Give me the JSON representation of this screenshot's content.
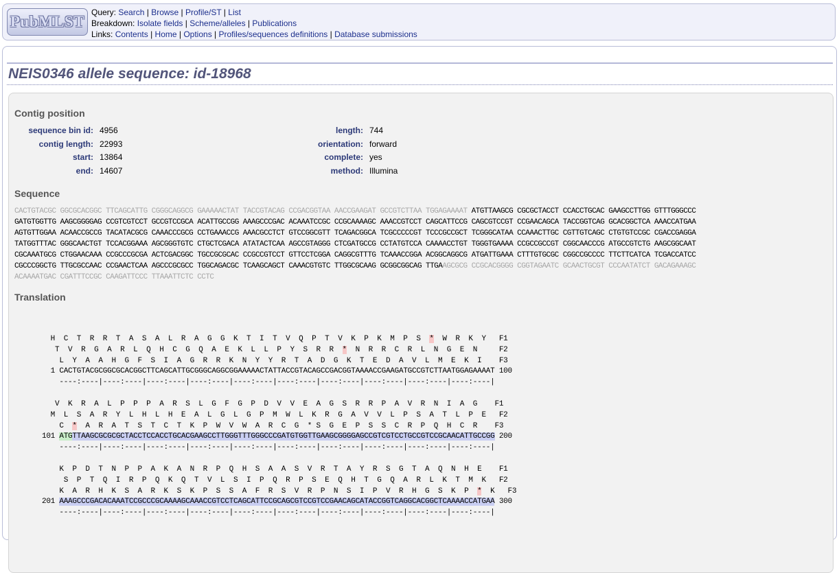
{
  "nav": {
    "logo_text": "PubMLST",
    "query_label": "Query:",
    "query_links": [
      "Search",
      "Browse",
      "Profile/ST",
      "List"
    ],
    "breakdown_label": "Breakdown:",
    "breakdown_links": [
      "Isolate fields",
      "Scheme/alleles",
      "Publications"
    ],
    "links_label": "Links:",
    "links_links": [
      "Contents",
      "Home",
      "Options",
      "Profiles/sequences definitions",
      "Database submissions"
    ]
  },
  "page_title": "NEIS0346 allele sequence: id-18968",
  "contig": {
    "heading": "Contig position",
    "left": [
      {
        "label": "sequence bin id:",
        "value": "4956"
      },
      {
        "label": "contig length:",
        "value": "22993"
      },
      {
        "label": "start:",
        "value": "13864"
      },
      {
        "label": "end:",
        "value": "14607"
      }
    ],
    "right": [
      {
        "label": "length:",
        "value": "744"
      },
      {
        "label": "orientation:",
        "value": "forward"
      },
      {
        "label": "complete:",
        "value": "yes"
      },
      {
        "label": "method:",
        "value": "Illumina"
      }
    ]
  },
  "sequence": {
    "heading": "Sequence",
    "lines": [
      {
        "flank": "CACTGTACGC GGCGCACGGC TTCAGCATTG CGGGCAGGCG GAAAAACTAT TACCGTACAG CCGACGGTAA AACCGAAGAT GCCGTCTTAA TGGAGAAAAT ",
        "core": "ATGTTAAGCG CGCGCTACCT CCACCTGCAC GAAGCCTTGG GTTTGGGCCC",
        "tail": ""
      },
      {
        "flank": "",
        "core": "GATGTGGTTG AAGCGGGGAG CCGTCGTCCT GCCGTCCGCA ACATTGCCGG AAAGCCCGAC ACAAATCCGC CCGCAAAAGC AAACCGTCCT CAGCATTCCG CAGCGTCCGT CCGAACAGCA TACCGGTCAG GCACGGCTCA AAACCATGAA",
        "tail": ""
      },
      {
        "flank": "",
        "core": "AGTGTTGGAA ACAACCGCCG TACATACGCG CAAACCCGCG CCTGAAACCG AAACGCCTCT GTCCGGCGTT TCAGACGGCA TCGCCCCCGT TCCCGCCGCT TCGGGCATAA CCAAACTTGC CGTTGTCAGC CTGTGTCCGC CGACCGAGGA",
        "tail": ""
      },
      {
        "flank": "",
        "core": "TATGGTTTAC GGGCAACTGT TCCACGGAAA AGCGGGTGTC CTGCTCGACA ATATACTCAA AGCCGTAGGG CTCGATGCCG CCTATGTCCA CAAAACCTGT TGGGTGAAAA CCGCCGCCGT CGGCAACCCG ATGCCGTCTG AAGCGGCAAT",
        "tail": ""
      },
      {
        "flank": "",
        "core": "CGCAAATGCG CTGGAACAAA CCGCCCGCGA ACTCGACGGC TGCCGCGCAC CCGCCGTCCT GTTCCTCGGA CAGGCGTTTG TCAAACCGGA ACGGCAGGCG ATGATTGAAA CTTTGTGCGC CGGCCGCCCC TTCTTCATCA TCGACCATCC",
        "tail": ""
      },
      {
        "flank": "",
        "core": "CGCCCGGCTG TTGCGCCAAC CCGAACTCAA AGCCCGCGCC TGGCAGACGC TCAAGCAGCT CAAACGTGTC TTGGCGCAAG GCGGCGGCAG TTGA",
        "tail": "AGCGCG CCGCACGGGG CGGTAGAATC GCAACTGCGT CCCAATATCT GACAGAAAGC"
      },
      {
        "flank": "",
        "core": "",
        "tail": "ACAAAATGAC CGATTTCCGC CAAGATTCCC TTAAATTCTC CCTC"
      }
    ]
  },
  "translation": {
    "heading": "Translation",
    "blocks": [
      {
        "f1": "  H  C  T  R  R  T  A  S  A  L  R  A  G  G  K  T  I  T  V  Q  P  T  V  K  P  K  M  P  S  ",
        "f1_stop": "*",
        "f1_tail": "  W  R  K  Y   F1",
        "f2": "   T  V  R  G  A  R  L  Q  H  C  G  Q  A  E  K  L  L  P  Y  S  R  R  ",
        "f2_stop": "*",
        "f2_tail": "  N  R  R  C  R  L  N  G  E  N     F2",
        "f3": "    L  Y  A  A  H  G  F  S  I  A  G  R  R  K  N  Y  Y  R  T  A  D  G  K  T  E  D  A  V  L  M  E  K  I    F3",
        "f3_stop": "",
        "f3_tail": "",
        "pos_start": "  1 ",
        "seq_pre": "CACTGTACGCGGCGCACGGCTTCAGCATTGCGGGCAGGCGGAAAAACTATTACCGTACAGCCGACGGTAAAACCGAAGATGCCGTCTTAATGGAGAAAAT",
        "seq_start": "",
        "seq_hl": "",
        "pos_end": " 100",
        "ruler": "    ----:----|----:----|----:----|----:----|----:----|----:----|----:----|----:----|----:----|----:----|"
      },
      {
        "f1": "   V  K  R  A  L  P  P  P  A  R  S  L  G  F  G  P  D  V  V  E  A  G  S  R  R  P  A  V  R  N  I  A  G    F1",
        "f1_stop": "",
        "f1_tail": "",
        "f2": "  M  L  S  A  R  Y  L  H  L  H  E  A  L  G  L  G  P  M  W  L  K  R  G  A  V  V  L  P  S  A  T  L  P  E   F2",
        "f2_stop": "",
        "f2_tail": "",
        "f3": "    C  ",
        "f3_stop": "*",
        "f3_tail": "  A  R  A  T  S  T  C  T  K  P  W  V  W  A  R  C  G  * S  G  E  P  S  S  C  R  P  Q  H  C  R    F3",
        "pos_start": "101 ",
        "seq_pre": "",
        "seq_start": "ATG",
        "seq_hl": "TTAAGCGCGCGCTACCTCCACCTGCACGAAGCCTTGGGTTTGGGCCCGATGTGGTTGAAGCGGGGAGCCGTCGTCCTGCCGTCCGCAACATTGCCGG",
        "pos_end": " 200",
        "ruler": "    ----:----|----:----|----:----|----:----|----:----|----:----|----:----|----:----|----:----|----:----|"
      },
      {
        "f1": "    K  P  D  T  N  P  P  A  K  A  N  R  P  Q  H  S  A  A  S  V  R  T  A  Y  R  S  G  T  A  Q  N  H  E    F1",
        "f1_stop": "",
        "f1_tail": "",
        "f2": "     S  P  T  Q  I  R  P  Q  K  Q  T  V  L  S  I  P  Q  R  P  S  E  Q  H  T  G  Q  A  R  L  K  T  M  K   F2",
        "f2_stop": "",
        "f2_tail": "",
        "f3": "    K  A  R  H  K  S  A  R  K  S  K  P  S  S  A  F  R  S  V  R  P  N  S  I  P  V  R  H  G  S  K  P  ",
        "f3_stop": "*",
        "f3_tail": "  K   F3",
        "pos_start": "201 ",
        "seq_pre": "",
        "seq_start": "",
        "seq_hl": "AAAGCCCGACACAAATCCGCCCGCAAAAGCAAACCGTCCTCAGCATTCCGCAGCGTCCGTCCGAACAGCATACCGGTCAGGCACGGCTCAAAACCATGAA",
        "pos_end": " 300",
        "ruler": "    ----:----|----:----|----:----|----:----|----:----|----:----|----:----|----:----|----:----|----:----|"
      }
    ]
  }
}
